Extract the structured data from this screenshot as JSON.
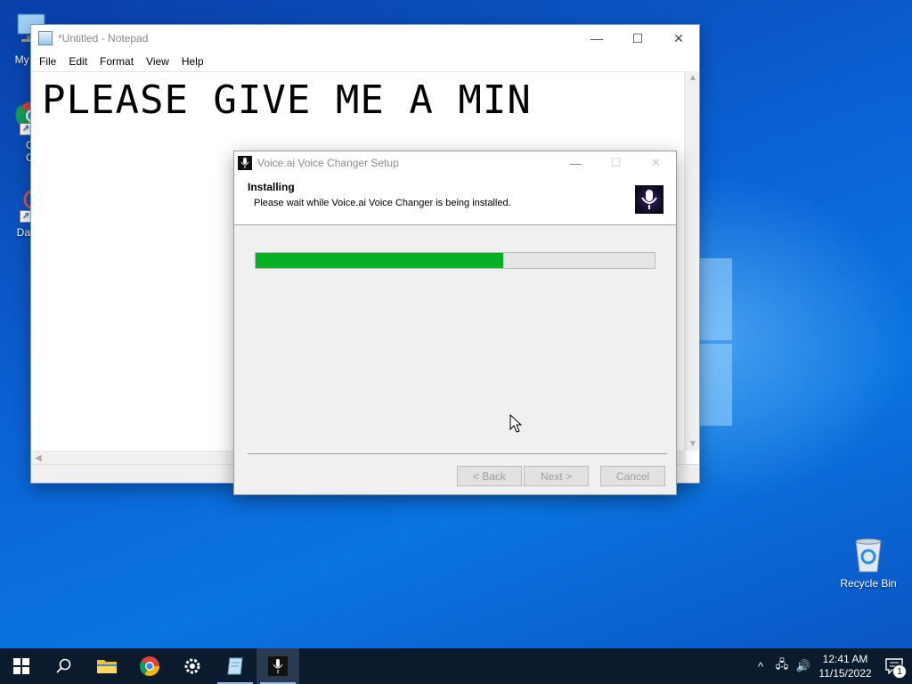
{
  "desktop": {
    "icons": [
      {
        "label": "My Co",
        "icon": "computer-icon"
      },
      {
        "label": "Go\nCh",
        "icon": "chrome-icon"
      },
      {
        "label": "DataW",
        "icon": "app-icon"
      },
      {
        "label": "Recycle Bin",
        "icon": "recycle-bin-icon"
      }
    ]
  },
  "notepad": {
    "title": "*Untitled - Notepad",
    "menu": [
      "File",
      "Edit",
      "Format",
      "View",
      "Help"
    ],
    "content": "PLEASE GIVE ME A MIN",
    "caption_buttons": {
      "minimize": "—",
      "maximize": "☐",
      "close": "✕"
    }
  },
  "installer": {
    "title": "Voice.ai Voice Changer Setup",
    "heading": "Installing",
    "subheading": "Please wait while Voice.ai Voice Changer is being installed.",
    "progress_fraction": 0.62,
    "buttons": {
      "back": "< Back",
      "next": "Next >",
      "cancel": "Cancel"
    },
    "caption_buttons": {
      "minimize": "—",
      "maximize": "☐",
      "close": "✕"
    }
  },
  "taskbar": {
    "apps": [
      "start-icon",
      "search-icon",
      "file-explorer-icon",
      "chrome-icon",
      "settings-icon",
      "notepad-icon",
      "voice-ai-icon"
    ],
    "clock": {
      "time": "12:41 AM",
      "date": "11/15/2022"
    },
    "notification_count": "1",
    "tray_icons": {
      "chevron": "^",
      "network": "🖧",
      "volume": "🔊"
    }
  },
  "colors": {
    "progress": "#06b025",
    "taskbar": "#0c1a2e",
    "desktop": "#0b63d6"
  }
}
